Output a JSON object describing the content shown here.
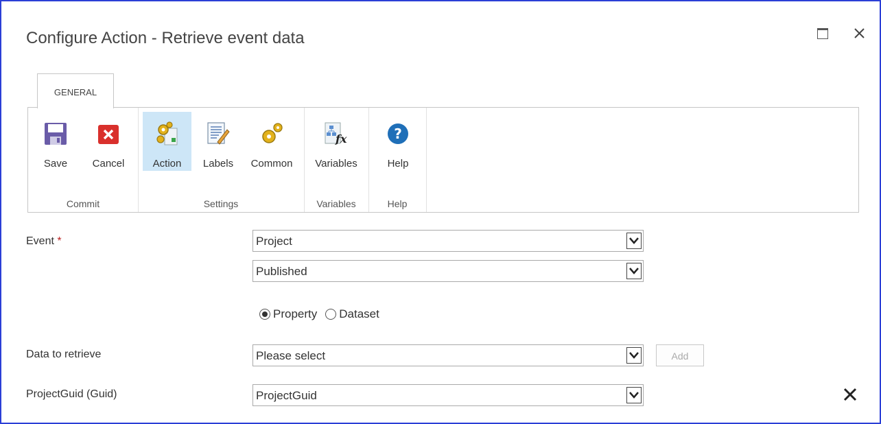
{
  "window": {
    "title": "Configure Action - Retrieve event data",
    "maximize_icon": "maximize-icon",
    "close_icon": "close-icon"
  },
  "ribbon": {
    "tab_label": "GENERAL",
    "groups": [
      {
        "label": "Commit",
        "buttons": [
          {
            "label": "Save",
            "icon": "save-icon"
          },
          {
            "label": "Cancel",
            "icon": "cancel-icon"
          }
        ]
      },
      {
        "label": "Settings",
        "buttons": [
          {
            "label": "Action",
            "icon": "action-gears-icon",
            "active": true
          },
          {
            "label": "Labels",
            "icon": "labels-icon"
          },
          {
            "label": "Common",
            "icon": "common-gears-icon"
          }
        ]
      },
      {
        "label": "Variables",
        "buttons": [
          {
            "label": "Variables",
            "icon": "variables-fx-icon"
          }
        ]
      },
      {
        "label": "Help",
        "buttons": [
          {
            "label": "Help",
            "icon": "help-icon"
          }
        ]
      }
    ]
  },
  "form": {
    "event_label": "Event",
    "required_marker": "*",
    "event_entity": "Project",
    "event_type": "Published",
    "mode_options": [
      "Property",
      "Dataset"
    ],
    "mode_selected": "Property",
    "data_label": "Data to retrieve",
    "data_value": "Please select",
    "add_label": "Add",
    "row_label": "ProjectGuid (Guid)",
    "row_value": "ProjectGuid",
    "remove_icon": "remove-icon"
  },
  "colors": {
    "frame_border": "#2b3fd6",
    "active_button": "#cde6f7",
    "required": "#bb2222"
  }
}
